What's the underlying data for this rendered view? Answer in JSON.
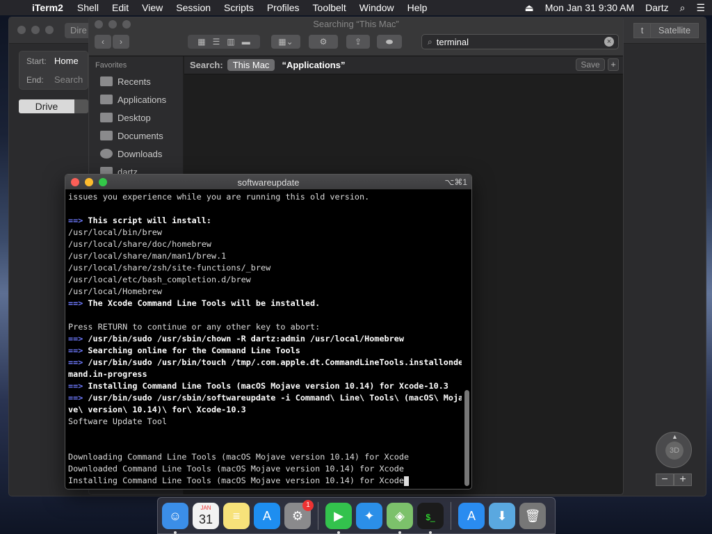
{
  "menubar": {
    "apple": "",
    "app_name": "iTerm2",
    "items": [
      "Shell",
      "Edit",
      "View",
      "Session",
      "Scripts",
      "Profiles",
      "Toolbelt",
      "Window",
      "Help"
    ],
    "eject": "⏏",
    "datetime": "Mon Jan 31  9:30 AM",
    "user": "Dartz",
    "search_icon": "⌕",
    "list_icon": "☰"
  },
  "maps": {
    "directions_label": "Dire",
    "map_types": [
      "t",
      "Satellite"
    ],
    "start_label": "Start:",
    "start_value": "Home",
    "end_label": "End:",
    "end_placeholder": "Search",
    "mode_selected": "Drive",
    "compass_label": "3D",
    "compass_n": "▲",
    "zoom_out": "−",
    "zoom_in": "+"
  },
  "finder": {
    "title": "Searching “This Mac”",
    "search_value": "terminal",
    "search_clear": "×",
    "search_icon": "⌕",
    "sidebar_header": "Favorites",
    "sidebar_items": [
      "Recents",
      "Applications",
      "Desktop",
      "Documents",
      "Downloads",
      "dartz"
    ],
    "search_label": "Search:",
    "scope_this_mac": "This Mac",
    "scope_applications": "“Applications”",
    "save_label": "Save",
    "add_label": "+",
    "back_glyph": "‹",
    "forward_glyph": "›",
    "gear_glyph": "⚙",
    "chevron_glyph": "⌄"
  },
  "terminal": {
    "title": "softwareupdate",
    "shortcut": "⌥⌘1",
    "lines": [
      {
        "arrow": "",
        "text": "issues you experience while you are running this old version.",
        "bold": false
      },
      {
        "arrow": "",
        "text": "",
        "bold": false
      },
      {
        "arrow": "==>",
        "text": "This script will install:",
        "bold": true
      },
      {
        "arrow": "",
        "text": "/usr/local/bin/brew",
        "bold": false
      },
      {
        "arrow": "",
        "text": "/usr/local/share/doc/homebrew",
        "bold": false
      },
      {
        "arrow": "",
        "text": "/usr/local/share/man/man1/brew.1",
        "bold": false
      },
      {
        "arrow": "",
        "text": "/usr/local/share/zsh/site-functions/_brew",
        "bold": false
      },
      {
        "arrow": "",
        "text": "/usr/local/etc/bash_completion.d/brew",
        "bold": false
      },
      {
        "arrow": "",
        "text": "/usr/local/Homebrew",
        "bold": false
      },
      {
        "arrow": "==>",
        "text": "The Xcode Command Line Tools will be installed.",
        "bold": true
      },
      {
        "arrow": "",
        "text": "",
        "bold": false
      },
      {
        "arrow": "",
        "text": "Press RETURN to continue or any other key to abort:",
        "bold": false
      },
      {
        "arrow": "==>",
        "text": "/usr/bin/sudo /usr/sbin/chown -R dartz:admin /usr/local/Homebrew",
        "bold": true
      },
      {
        "arrow": "==>",
        "text": "Searching online for the Command Line Tools",
        "bold": true
      },
      {
        "arrow": "==>",
        "text": "/usr/bin/sudo /usr/bin/touch /tmp/.com.apple.dt.CommandLineTools.installonde",
        "bold": true
      },
      {
        "arrow": "",
        "text": "mand.in-progress",
        "bold": true
      },
      {
        "arrow": "==>",
        "text": "Installing Command Line Tools (macOS Mojave version 10.14) for Xcode-10.3",
        "bold": true
      },
      {
        "arrow": "==>",
        "text": "/usr/bin/sudo /usr/sbin/softwareupdate -i Command\\ Line\\ Tools\\ (macOS\\ Moja",
        "bold": true
      },
      {
        "arrow": "",
        "text": "ve\\ version\\ 10.14)\\ for\\ Xcode-10.3",
        "bold": true
      },
      {
        "arrow": "",
        "text": "Software Update Tool",
        "bold": false
      },
      {
        "arrow": "",
        "text": "",
        "bold": false
      },
      {
        "arrow": "",
        "text": "",
        "bold": false
      },
      {
        "arrow": "",
        "text": "Downloading Command Line Tools (macOS Mojave version 10.14) for Xcode",
        "bold": false
      },
      {
        "arrow": "",
        "text": "Downloaded Command Line Tools (macOS Mojave version 10.14) for Xcode",
        "bold": false
      },
      {
        "arrow": "",
        "text": "Installing Command Line Tools (macOS Mojave version 10.14) for Xcode",
        "bold": false
      }
    ]
  },
  "dock": {
    "icons": [
      {
        "name": "finder-icon",
        "glyph": "☺",
        "color": "#3b8ee8",
        "running": true,
        "badge": ""
      },
      {
        "name": "calendar-icon",
        "glyph": "31",
        "color": "#f2f2f2",
        "running": false,
        "badge": "",
        "month": "JAN"
      },
      {
        "name": "notes-icon",
        "glyph": "≡",
        "color": "#f7e27a",
        "running": false,
        "badge": ""
      },
      {
        "name": "app-store-icon",
        "glyph": "A",
        "color": "#1e8ef0",
        "running": false,
        "badge": ""
      },
      {
        "name": "system-preferences-icon",
        "glyph": "⚙",
        "color": "#8a8a8c",
        "running": false,
        "badge": "1"
      },
      {
        "sep": true
      },
      {
        "name": "facetime-icon",
        "glyph": "▶",
        "color": "#33c24d",
        "running": true,
        "badge": ""
      },
      {
        "name": "safari-icon",
        "glyph": "✦",
        "color": "#2b8fe8",
        "running": false,
        "badge": ""
      },
      {
        "name": "maps-icon",
        "glyph": "◈",
        "color": "#7cc16b",
        "running": true,
        "badge": ""
      },
      {
        "name": "iterm-icon",
        "glyph": "$_",
        "color": "#1b1b1b",
        "running": true,
        "badge": ""
      },
      {
        "sep": true
      },
      {
        "name": "app-store-folder-icon",
        "glyph": "A",
        "color": "#2a8cf0",
        "running": false,
        "badge": ""
      },
      {
        "name": "downloads-folder-icon",
        "glyph": "⬇",
        "color": "#5aa8e0",
        "running": false,
        "badge": ""
      },
      {
        "name": "trash-icon",
        "glyph": "🗑",
        "color": "#777",
        "running": false,
        "badge": ""
      }
    ]
  }
}
